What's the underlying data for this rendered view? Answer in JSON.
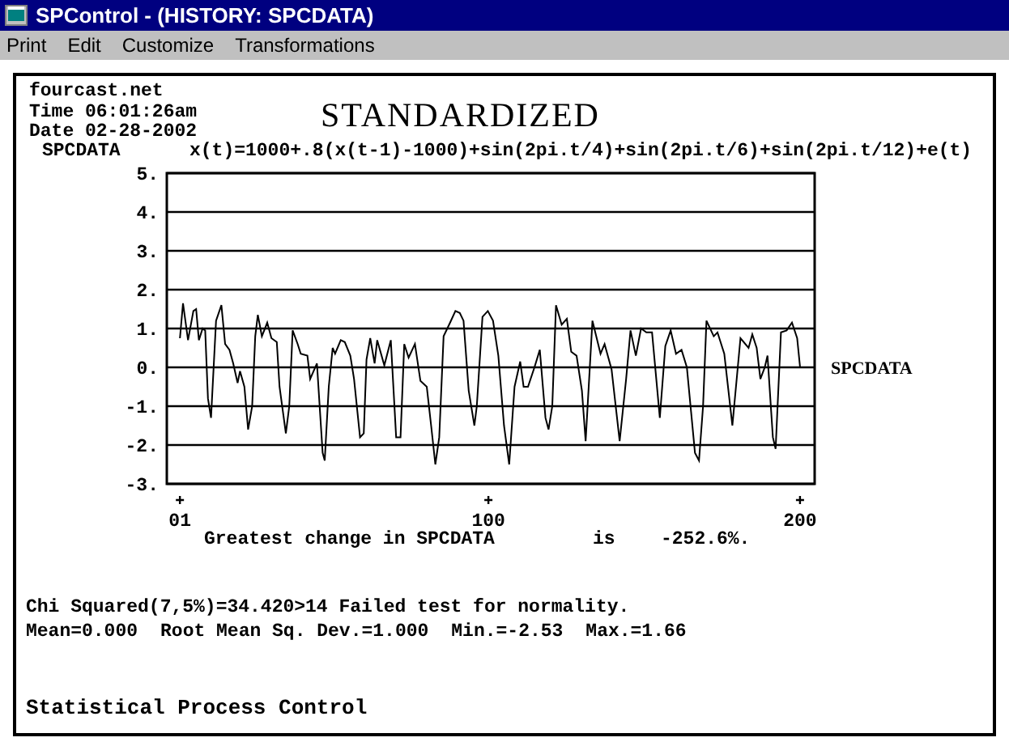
{
  "window": {
    "title": "SPControl - (HISTORY: SPCDATA)"
  },
  "menu": [
    {
      "label": "Print"
    },
    {
      "label": "Edit"
    },
    {
      "label": "Customize"
    },
    {
      "label": "Transformations"
    }
  ],
  "report": {
    "site": "fourcast.net",
    "time": "Time 06:01:26am",
    "date": "Date 02-28-2002",
    "title": "STANDARDIZED",
    "series_name": "SPCDATA",
    "formula": "x(t)=1000+.8(x(t-1)-1000)+sin(2pi.t/4)+sin(2pi.t/6)+sin(2pi.t/12)+e(t)",
    "chart_data": {
      "type": "line",
      "grid": true,
      "xlim": [
        -3.2,
        204.7
      ],
      "ylim": [
        -3,
        5
      ],
      "yticks": [
        {
          "value": 5,
          "label": "5."
        },
        {
          "value": 4,
          "label": "4."
        },
        {
          "value": 3,
          "label": "3."
        },
        {
          "value": 2,
          "label": "2."
        },
        {
          "value": 1,
          "label": "1."
        },
        {
          "value": 0,
          "label": "0."
        },
        {
          "value": -1,
          "label": "-1."
        },
        {
          "value": -2,
          "label": "-2."
        },
        {
          "value": -3,
          "label": "-3."
        }
      ],
      "xticks": [
        {
          "value": 1,
          "label": "01"
        },
        {
          "value": 100,
          "label": "100"
        },
        {
          "value": 200,
          "label": "200"
        }
      ],
      "x": [
        1,
        2,
        3.6,
        5.3,
        6.2,
        7.1,
        8.3,
        9.1,
        10,
        11,
        12.6,
        14.3,
        15.5,
        16.9,
        18.1,
        19.5,
        20.3,
        21.7,
        22.9,
        24.2,
        25.2,
        26,
        27.3,
        29,
        30.4,
        32.1,
        33,
        35,
        36.1,
        37.2,
        38.8,
        39.8,
        41.9,
        42.8,
        45,
        46.8,
        47.5,
        48.8,
        50,
        50.8,
        52.6,
        53.9,
        55.7,
        56.9,
        58.8,
        60,
        60.9,
        62.1,
        63.5,
        64.3,
        66.6,
        68.7,
        70.4,
        71.8,
        73,
        74.4,
        76.4,
        78.2,
        80.2,
        81.6,
        83,
        84.2,
        85.6,
        87.7,
        89.4,
        90.8,
        92,
        93.7,
        95.5,
        96.3,
        98.1,
        99.8,
        101.5,
        103.2,
        105,
        106.7,
        108.4,
        110.2,
        111.3,
        112.7,
        114.8,
        116.5,
        118.3,
        119.3,
        120.5,
        121.7,
        123.5,
        125.2,
        126.6,
        128.3,
        130,
        131.2,
        133.4,
        136,
        137.3,
        139.5,
        142.1,
        144.2,
        145.6,
        147.3,
        149,
        150.7,
        152.5,
        155,
        156.8,
        158.5,
        160.2,
        162,
        163.7,
        166.3,
        167.6,
        168.9,
        170,
        172.3,
        173.5,
        175.7,
        178.3,
        180.9,
        183.5,
        184.7,
        186.1,
        187.3,
        188.7,
        189.6,
        191.3,
        192.2,
        193.9,
        195.7,
        197.4,
        199.1,
        200
      ],
      "series": [
        {
          "name": "SPCDATA",
          "color": "#000000",
          "values": [
            0.75,
            1.65,
            0.7,
            1.45,
            1.5,
            0.7,
            1.0,
            0.95,
            -0.8,
            -1.3,
            1.2,
            1.6,
            0.6,
            0.45,
            0.1,
            -0.4,
            -0.1,
            -0.5,
            -1.6,
            -1.0,
            0.8,
            1.35,
            0.8,
            1.15,
            0.75,
            0.65,
            -0.5,
            -1.7,
            -1.0,
            0.95,
            0.6,
            0.35,
            0.3,
            -0.3,
            0.1,
            -2.2,
            -2.4,
            -0.5,
            0.5,
            0.35,
            0.7,
            0.65,
            0.3,
            -0.3,
            -1.8,
            -1.7,
            0.2,
            0.75,
            0.1,
            0.7,
            0.05,
            0.7,
            -1.8,
            -1.8,
            0.6,
            0.25,
            0.6,
            -0.35,
            -0.5,
            -1.5,
            -2.5,
            -1.8,
            0.8,
            1.15,
            1.45,
            1.4,
            1.2,
            -0.6,
            -1.5,
            -1.0,
            1.3,
            1.45,
            1.2,
            0.3,
            -1.5,
            -2.5,
            -0.5,
            0.15,
            -0.5,
            -0.5,
            0.0,
            0.45,
            -1.3,
            -1.6,
            -1.0,
            1.6,
            1.1,
            1.25,
            0.4,
            0.3,
            -0.6,
            -1.9,
            1.2,
            0.35,
            0.6,
            -0.05,
            -1.9,
            -0.3,
            0.95,
            0.3,
            1.0,
            0.9,
            0.9,
            -1.3,
            0.55,
            0.95,
            0.35,
            0.45,
            0.0,
            -2.2,
            -2.4,
            -1.0,
            1.2,
            0.8,
            0.9,
            0.35,
            -1.5,
            0.75,
            0.5,
            0.85,
            0.5,
            -0.3,
            0.0,
            0.3,
            -1.8,
            -2.1,
            0.9,
            0.95,
            1.15,
            0.75,
            0.0
          ]
        }
      ]
    },
    "change_label": "Greatest change in SPCDATA",
    "change_is": "is",
    "change_value": "-252.6%.",
    "chi_line": "Chi Squared(7,5%)=34.420>14 Failed test for normality.",
    "stats": [
      "Mean=0.000",
      "Root Mean Sq. Dev.=1.000",
      "Min.=-2.53",
      "Max.=1.66"
    ],
    "footer": "Statistical Process Control"
  }
}
